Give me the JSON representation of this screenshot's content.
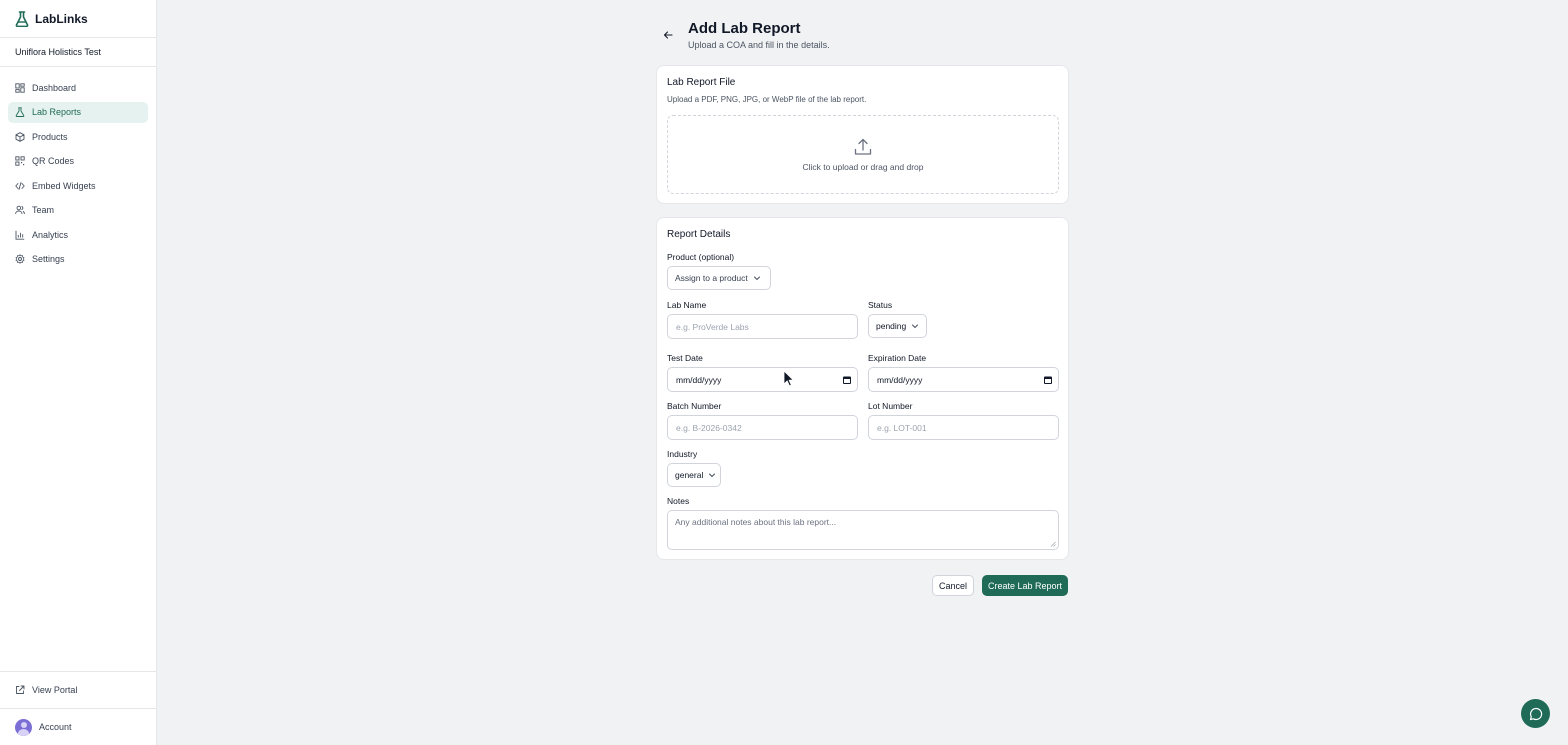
{
  "app": {
    "name": "LabLinks",
    "org": "Uniflora Holistics Test"
  },
  "colors": {
    "accent": "#1f6b57",
    "active_bg": "#e6f2ef"
  },
  "sidebar": {
    "items": [
      {
        "label": "Dashboard",
        "icon": "dashboard-icon"
      },
      {
        "label": "Lab Reports",
        "icon": "flask-icon",
        "active": true
      },
      {
        "label": "Products",
        "icon": "package-icon"
      },
      {
        "label": "QR Codes",
        "icon": "qr-code-icon"
      },
      {
        "label": "Embed Widgets",
        "icon": "code-icon"
      },
      {
        "label": "Team",
        "icon": "users-icon"
      },
      {
        "label": "Analytics",
        "icon": "bar-chart-icon"
      },
      {
        "label": "Settings",
        "icon": "gear-icon"
      }
    ],
    "view_portal": "View Portal",
    "account": "Account"
  },
  "page": {
    "title": "Add Lab Report",
    "subtitle": "Upload a COA and fill in the details."
  },
  "file_card": {
    "title": "Lab Report File",
    "desc": "Upload a PDF, PNG, JPG, or WebP file of the lab report.",
    "dropzone_text": "Click to upload or drag and drop"
  },
  "details": {
    "title": "Report Details",
    "product_label": "Product (optional)",
    "product_value": "Assign to a product",
    "lab_name_label": "Lab Name",
    "lab_name_placeholder": "e.g. ProVerde Labs",
    "status_label": "Status",
    "status_value": "pending",
    "test_date_label": "Test Date",
    "test_date_value": "mm/dd/yyyy",
    "expiration_label": "Expiration Date",
    "expiration_value": "mm/dd/yyyy",
    "batch_label": "Batch Number",
    "batch_placeholder": "e.g. B-2026-0342",
    "lot_label": "Lot Number",
    "lot_placeholder": "e.g. LOT-001",
    "industry_label": "Industry",
    "industry_value": "general",
    "notes_label": "Notes",
    "notes_placeholder": "Any additional notes about this lab report..."
  },
  "actions": {
    "cancel": "Cancel",
    "create": "Create Lab Report"
  }
}
